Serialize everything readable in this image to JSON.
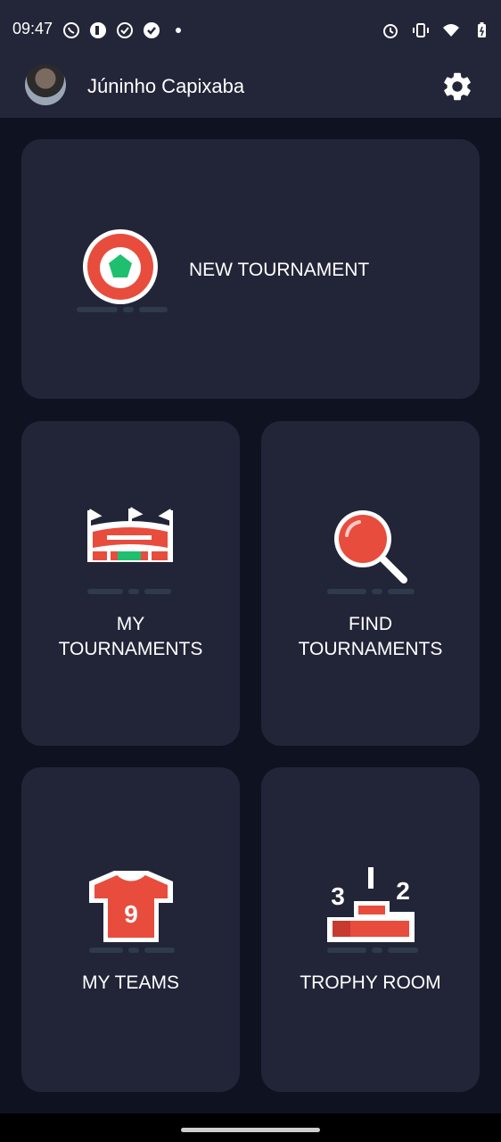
{
  "status_bar": {
    "time": "09:47",
    "left_icons": [
      "whatsapp-icon",
      "badge-icon",
      "check-circle-icon",
      "check-circle-filled-icon",
      "dot-icon"
    ],
    "right_icons": [
      "alarm-icon",
      "vibrate-icon",
      "wifi-icon",
      "battery-icon"
    ]
  },
  "app_bar": {
    "username": "Júninho Capixaba",
    "settings_icon": "gear-icon"
  },
  "menu": {
    "new_tournament": "NEW TOURNAMENT",
    "my_tournaments": [
      "MY",
      "TOURNAMENTS"
    ],
    "find_tournaments": [
      "FIND",
      "TOURNAMENTS"
    ],
    "my_teams": "MY TEAMS",
    "trophy_room": "TROPHY ROOM"
  },
  "colors": {
    "background": "#0f1220",
    "card": "#222538",
    "accent_red": "#e84c3d",
    "accent_green": "#1fbf6f"
  }
}
